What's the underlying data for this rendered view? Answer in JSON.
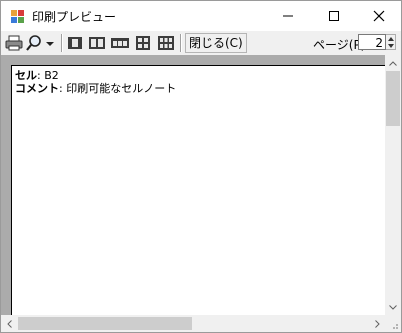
{
  "window": {
    "title": "印刷プレビュー"
  },
  "toolbar": {
    "close_label": "閉じる(C)",
    "page_label": "ページ(P)",
    "page_value": "2"
  },
  "preview": {
    "cell_key": "セル",
    "cell_value": ": B2",
    "comment_key": "コメント",
    "comment_value": ": 印刷可能なセルノート"
  }
}
